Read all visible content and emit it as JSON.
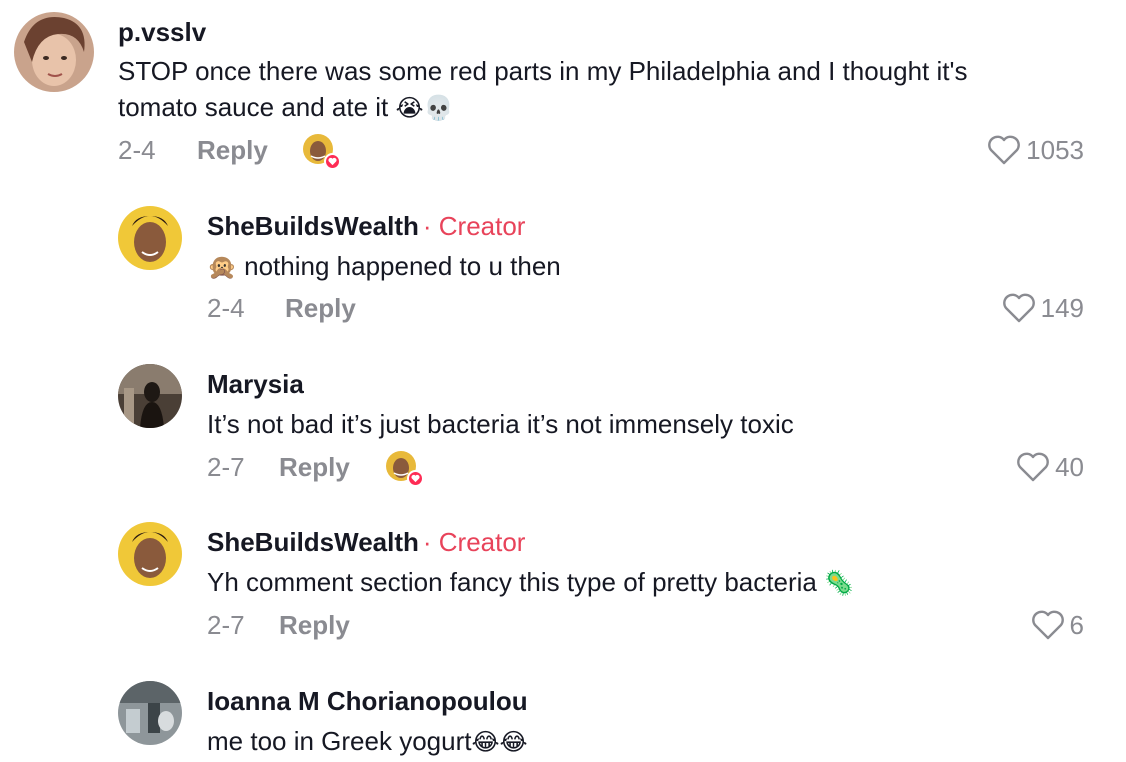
{
  "comments": [
    {
      "username": "p.vsslv",
      "creator_tag": "",
      "text": "STOP once there was some red parts in my Philadelphia and I thought it's",
      "text2": "tomato sauce and ate it",
      "emoji_after": "😭💀",
      "date": "2-4",
      "reply": "Reply",
      "likes": "1053",
      "liked_by_creator": true
    },
    {
      "username": "SheBuildsWealth",
      "creator_tag": "· Creator",
      "emoji_before": "🙊",
      "text": "nothing happened to u then",
      "date": "2-4",
      "reply": "Reply",
      "likes": "149",
      "liked_by_creator": false
    },
    {
      "username": "Marysia",
      "creator_tag": "",
      "text": "It’s not bad it’s just bacteria it’s not immensely toxic",
      "date": "2-7",
      "reply": "Reply",
      "likes": "40",
      "liked_by_creator": true
    },
    {
      "username": "SheBuildsWealth",
      "creator_tag": "· Creator",
      "text": "Yh comment section fancy this type of pretty bacteria",
      "emoji_after": "🦠",
      "date": "2-7",
      "reply": "Reply",
      "likes": "6",
      "liked_by_creator": false
    },
    {
      "username": "Ioanna M Chorianopoulou",
      "creator_tag": "",
      "text": "me too in Greek yogurt",
      "emoji_after": "😂😂"
    }
  ],
  "colors": {
    "creator": "#e8435a",
    "muted": "#8a8b91",
    "like_badge": "#fe2c55"
  },
  "icons": {
    "like": "heart-outline-icon",
    "creator_liked_badge": "heart-filled-icon"
  }
}
